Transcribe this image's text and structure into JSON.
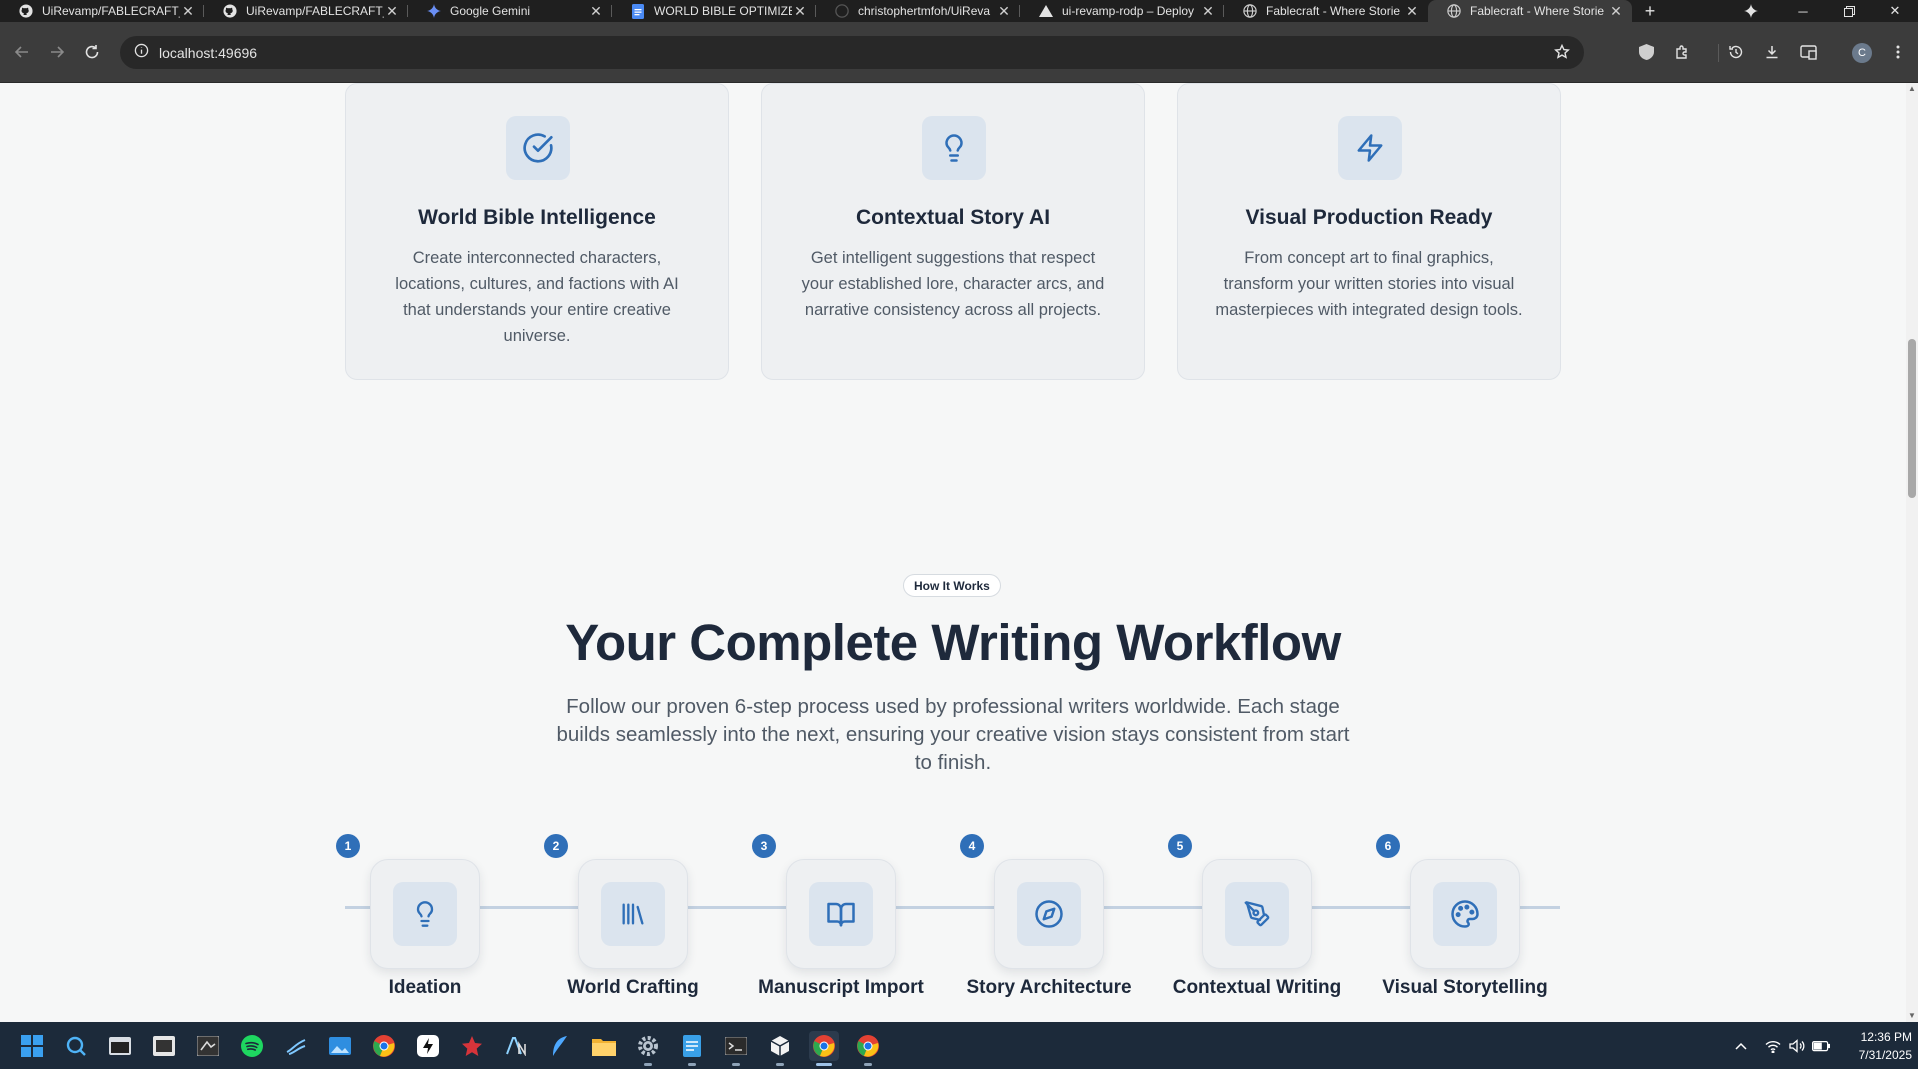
{
  "browser": {
    "tabs": [
      {
        "title": "UiRevamp/FABLECRAFT_",
        "icon": "github-icon"
      },
      {
        "title": "UiRevamp/FABLECRAFT_",
        "icon": "github-icon"
      },
      {
        "title": "Google Gemini",
        "icon": "gemini-icon"
      },
      {
        "title": "WORLD BIBLE OPTIMIZE",
        "icon": "docs-icon"
      },
      {
        "title": "christophertmfoh/UiReva",
        "icon": "github-icon"
      },
      {
        "title": "ui-revamp-rodp – Deploy",
        "icon": "vercel-icon"
      },
      {
        "title": "Fablecraft - Where Storie",
        "icon": "globe-icon"
      },
      {
        "title": "Fablecraft - Where Storie",
        "icon": "globe-icon"
      }
    ],
    "active_tab": 7,
    "url": "localhost:49696",
    "profile_initial": "C"
  },
  "features": [
    {
      "title": "World Bible Intelligence",
      "description": "Create interconnected characters, locations, cultures, and factions with AI that understands your entire creative universe.",
      "icon": "check-circle-icon"
    },
    {
      "title": "Contextual Story AI",
      "description": "Get intelligent suggestions that respect your established lore, character arcs, and narrative consistency across all projects.",
      "icon": "lightbulb-icon"
    },
    {
      "title": "Visual Production Ready",
      "description": "From concept art to final graphics, transform your written stories into visual masterpieces with integrated design tools.",
      "icon": "lightning-icon"
    }
  ],
  "workflow": {
    "badge": "How It Works",
    "title": "Your Complete Writing Workflow",
    "subtitle": "Follow our proven 6-step process used by professional writers worldwide. Each stage builds seamlessly into the next, ensuring your creative vision stays consistent from start to finish.",
    "steps": [
      {
        "num": "1",
        "label": "Ideation",
        "icon": "lightbulb-icon"
      },
      {
        "num": "2",
        "label": "World Crafting",
        "icon": "library-icon"
      },
      {
        "num": "3",
        "label": "Manuscript Import",
        "icon": "book-open-icon"
      },
      {
        "num": "4",
        "label": "Story Architecture",
        "icon": "compass-icon"
      },
      {
        "num": "5",
        "label": "Contextual Writing",
        "icon": "pen-tool-icon"
      },
      {
        "num": "6",
        "label": "Visual Storytelling",
        "icon": "palette-icon"
      }
    ]
  },
  "taskbar": {
    "time": "12:36 PM",
    "date": "7/31/2025"
  },
  "colors": {
    "accent": "#2f6fb8",
    "icon_bg": "#dbe4ee",
    "card_bg": "#eef0f2",
    "page_bg": "#f6f7f7"
  }
}
